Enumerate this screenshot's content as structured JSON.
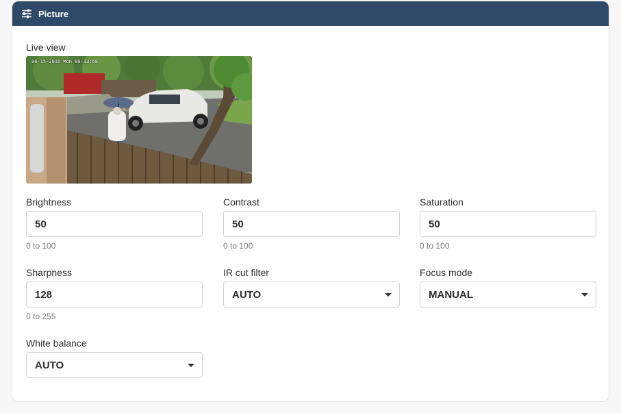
{
  "header": {
    "title": "Picture",
    "icon": "sliders-icon",
    "background": "#2f4a68"
  },
  "live_view": {
    "label": "Live view",
    "overlay_text": "06-15-2016 Mon 09:13:58"
  },
  "fields": {
    "brightness": {
      "label": "Brightness",
      "value": "50",
      "hint": "0 to 100"
    },
    "contrast": {
      "label": "Contrast",
      "value": "50",
      "hint": "0 to 100"
    },
    "saturation": {
      "label": "Saturation",
      "value": "50",
      "hint": "0 to 100"
    },
    "sharpness": {
      "label": "Sharpness",
      "value": "128",
      "hint": "0 to 255"
    },
    "ir_cut_filter": {
      "label": "IR cut filter",
      "value": "AUTO"
    },
    "focus_mode": {
      "label": "Focus mode",
      "value": "MANUAL"
    },
    "white_balance": {
      "label": "White balance",
      "value": "AUTO"
    }
  }
}
